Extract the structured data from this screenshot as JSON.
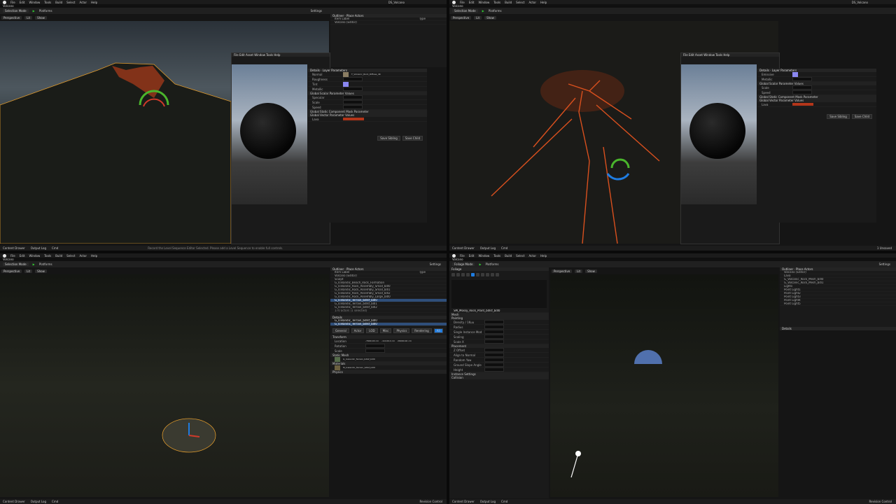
{
  "menu": [
    "File",
    "Edit",
    "Window",
    "Tools",
    "Build",
    "Select",
    "Actor",
    "Help"
  ],
  "tab": "Volcano",
  "project": "DS_Volcano",
  "toolbar": {
    "mode": "Selection Mode",
    "platforms": "Platforms",
    "settings": "Settings",
    "foliage": "Foliage Mode"
  },
  "viewport": {
    "perspective": "Perspective",
    "lit": "Lit",
    "show": "Show"
  },
  "outliner": {
    "title": "Outliner",
    "place": "Place Actors",
    "search": "Search...",
    "col_label": "Item Label",
    "col_type": "Type",
    "q3_rows": [
      "Volcano (Editor)",
      "Sculpt",
      "G_Icelandic_Beach_Rock_Formation",
      "G_Icelandic_Rock_Assembly_Small_bdl0",
      "G_Icelandic_Rock_Assembly_Small_bdl1",
      "G_Icelandic_Rock_Assembly_Small_bdl2",
      "G_Icelandic_Rock_Assembly_Large_bdl0",
      "G_Icelandic_Terrain_bdlsf_bdl0",
      "G_Icelandic_Terrain_bdlsf_bdl1",
      "G_Icelandic_Terrain_bdlsf_bdl2"
    ],
    "q3_selected": "G_Icelandic_Terrain_bdlsf_bdl0",
    "q3_count": "170 actors (1 selected)",
    "q4_rows": [
      "Volcano (Editor)",
      "Lava",
      "G_Volcanic_Rock_Mesh_bdl0",
      "G_Volcanic_Rock_Mesh_bdl1",
      "Lights",
      "Point Light1",
      "Point Light2",
      "Point Light3",
      "Point Light4",
      "Point Light5"
    ]
  },
  "details": {
    "title": "Details",
    "layer": "Layer Parameters",
    "q3_actor": "G_Icelandic_Terrain_bdlsf_bdl0",
    "q3_tabs": [
      "General",
      "Actor",
      "LOD",
      "Misc",
      "Physics",
      "Rendering",
      "Streaming",
      "All"
    ],
    "q3_transform": [
      "Location",
      "Rotation",
      "Scale"
    ],
    "q3_loc": [
      "-7900.00 cm",
      "-11100.0 cm",
      "26000.00 cm"
    ],
    "q3_static": "G_Icelandic_Terrain_bdlsf_bdl0",
    "q3_material": "M_Icelandic_Terrain_bdlsf_bdl0",
    "q3_sections": [
      "Transform",
      "Static Mesh",
      "Materials",
      "Physics"
    ],
    "save_sibling": "Save Sibling",
    "save_child": "Save Child"
  },
  "mat": {
    "global_vector": "Global Vector Parameter Values",
    "global_scalar": "Global Scalar Parameter Values",
    "global_static": "Global Static Component Mask Parameter",
    "labels": [
      "Normal",
      "Roughness",
      "Tint",
      "Metallic",
      "Specular",
      "Emissive",
      "Lava",
      "Scale",
      "Speed"
    ],
    "texture_name": "T_Volcanic_Rock_Diffuse_4K",
    "values": [
      "0.5",
      "1.0",
      "0.2",
      "0.0",
      "2.0"
    ]
  },
  "foliage": {
    "title": "Foliage",
    "tools": [
      "Select",
      "All",
      "Invalid",
      "Lasso",
      "Paint",
      "Reapply",
      "Single",
      "Fill",
      "Erase",
      "Remove"
    ],
    "mesh": "SM_Mossy_Rock_Plant_bdlsf_bdl0",
    "sections": [
      "Mesh",
      "Painting",
      "Placement",
      "Instance Settings",
      "Collision"
    ],
    "props": [
      "Density / 1Kuu",
      "Radius",
      "Single Instance Mode",
      "Scaling",
      "Scale X",
      "Z Offset",
      "Align to Normal",
      "Random Yaw",
      "Ground Slope Angle",
      "Height"
    ]
  },
  "status": {
    "content": "Content Drawer",
    "log": "Output Log",
    "cmd": "Cmd",
    "trace": "Trace",
    "derived": "Derived Data",
    "unsaved": "1 Unsaved",
    "revision": "Revision Control"
  },
  "notice": "Record the Level Sequence Editor Selected. Please add a Level Sequence to enable full controls.",
  "colors": {
    "lava": "#d9501e",
    "select": "#2f4f7a",
    "orange_outline": "#e09a2b",
    "accent": "#1f7ce0"
  }
}
